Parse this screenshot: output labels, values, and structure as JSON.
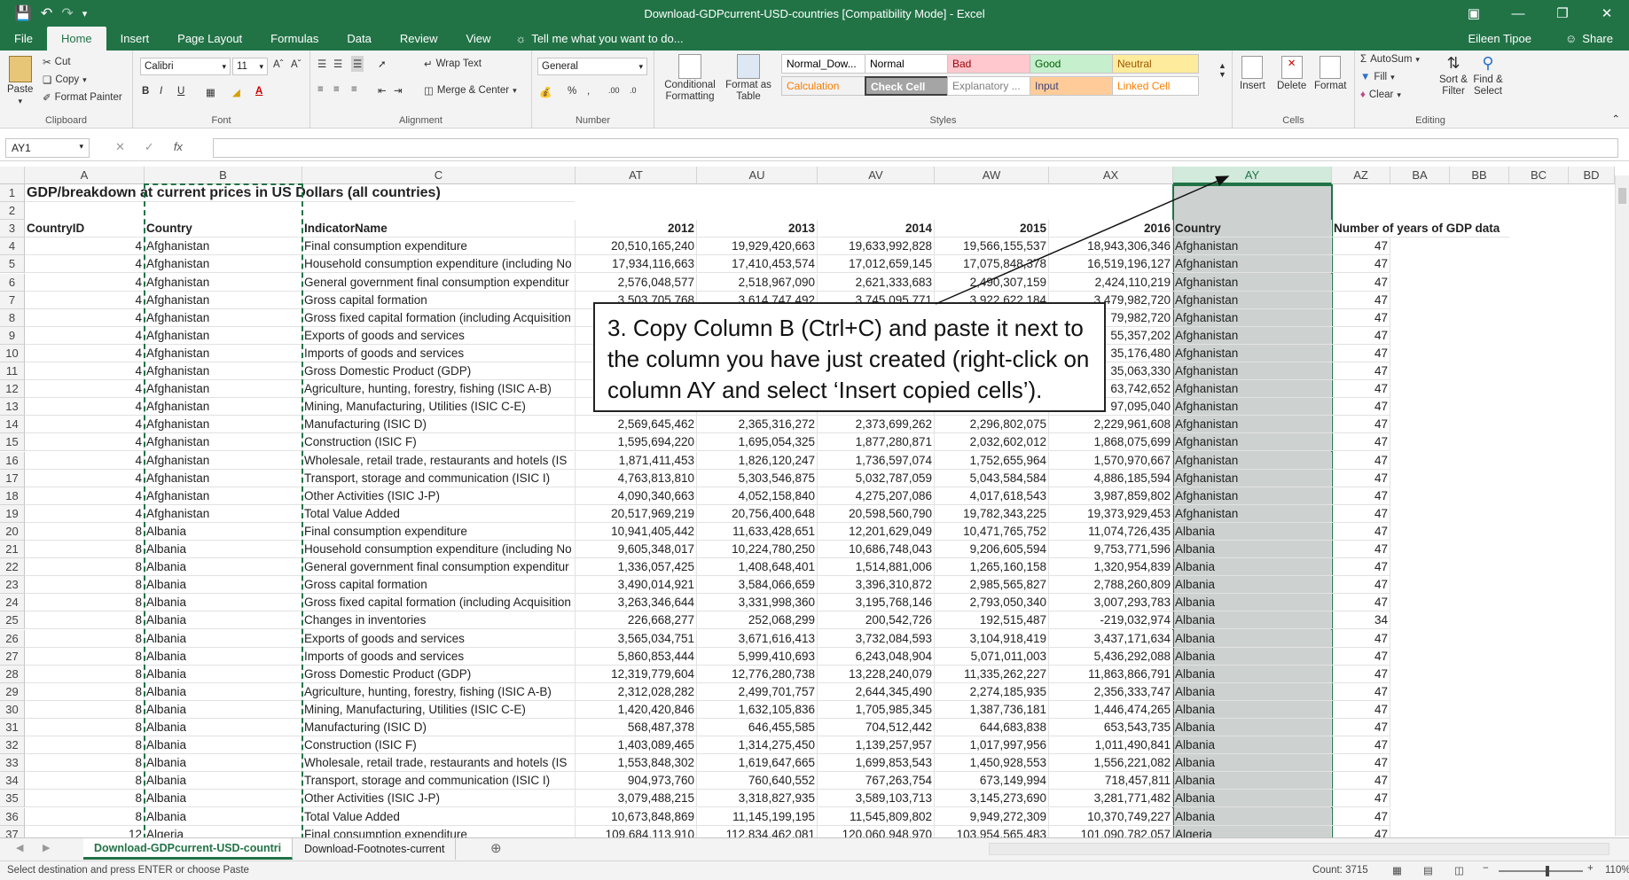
{
  "window": {
    "title": "Download-GDPcurrent-USD-countries  [Compatibility Mode] - Excel"
  },
  "tabs": [
    "File",
    "Home",
    "Insert",
    "Page Layout",
    "Formulas",
    "Data",
    "Review",
    "View"
  ],
  "tell_me": "Tell me what you want to do...",
  "user": "Eileen Tipoe",
  "share": "Share",
  "ribbon": {
    "clipboard": {
      "paste": "Paste",
      "cut": "Cut",
      "copy": "Copy",
      "format_painter": "Format Painter",
      "label": "Clipboard"
    },
    "font": {
      "name": "Calibri",
      "size": "11",
      "label": "Font"
    },
    "alignment": {
      "wrap": "Wrap Text",
      "merge": "Merge & Center",
      "label": "Alignment"
    },
    "number": {
      "format": "General",
      "label": "Number"
    },
    "styles": {
      "cond_fmt": "Conditional Formatting",
      "format_table": "Format as Table",
      "cells": [
        {
          "text": "Normal_Dow...",
          "bg": "#ffffff",
          "fg": "#000000"
        },
        {
          "text": "Normal",
          "bg": "#ffffff",
          "fg": "#000000"
        },
        {
          "text": "Bad",
          "bg": "#ffc7ce",
          "fg": "#9c0006"
        },
        {
          "text": "Good",
          "bg": "#c6efce",
          "fg": "#006100"
        },
        {
          "text": "Neutral",
          "bg": "#ffeb9c",
          "fg": "#9c5700"
        },
        {
          "text": "Calculation",
          "bg": "#f2f2f2",
          "fg": "#fa7d00"
        },
        {
          "text": "Check Cell",
          "bg": "#a5a5a5",
          "fg": "#ffffff"
        },
        {
          "text": "Explanatory ...",
          "bg": "#ffffff",
          "fg": "#7f7f7f"
        },
        {
          "text": "Input",
          "bg": "#ffcc99",
          "fg": "#3f3f76"
        },
        {
          "text": "Linked Cell",
          "bg": "#ffffff",
          "fg": "#fa7d00"
        }
      ],
      "label": "Styles"
    },
    "cells": {
      "insert": "Insert",
      "delete": "Delete",
      "format": "Format",
      "label": "Cells"
    },
    "editing": {
      "autosum": "AutoSum",
      "fill": "Fill",
      "clear": "Clear",
      "sort": "Sort & Filter",
      "find": "Find & Select",
      "label": "Editing"
    }
  },
  "formula_bar": {
    "name_box": "AY1",
    "fx": "fx",
    "value": ""
  },
  "columns": [
    "A",
    "B",
    "C",
    "AT",
    "AU",
    "AV",
    "AW",
    "AX",
    "AY",
    "AZ",
    "BA",
    "BB",
    "BC",
    "BD"
  ],
  "row1_title": "GDP/breakdown at current prices in US Dollars (all countries)",
  "headers": {
    "A": "CountryID",
    "B": "Country",
    "C": "IndicatorName",
    "AT": "2012",
    "AU": "2013",
    "AV": "2014",
    "AW": "2015",
    "AX": "2016",
    "AY": "Country",
    "AZ": "Number of years of GDP data"
  },
  "rows": [
    {
      "n": "4",
      "id": "4",
      "country": "Afghanistan",
      "ind": "Final consumption expenditure",
      "v": [
        "20,510,165,240",
        "19,929,420,663",
        "19,633,992,828",
        "19,566,155,537",
        "18,943,306,346"
      ],
      "ay": "Afghanistan",
      "az": "47"
    },
    {
      "n": "5",
      "id": "4",
      "country": "Afghanistan",
      "ind": "Household consumption expenditure (including No",
      "v": [
        "17,934,116,663",
        "17,410,453,574",
        "17,012,659,145",
        "17,075,848,378",
        "16,519,196,127"
      ],
      "ay": "Afghanistan",
      "az": "47"
    },
    {
      "n": "6",
      "id": "4",
      "country": "Afghanistan",
      "ind": "General government final consumption expenditur",
      "v": [
        "2,576,048,577",
        "2,518,967,090",
        "2,621,333,683",
        "2,490,307,159",
        "2,424,110,219"
      ],
      "ay": "Afghanistan",
      "az": "47"
    },
    {
      "n": "7",
      "id": "4",
      "country": "Afghanistan",
      "ind": "Gross capital formation",
      "v": [
        "3,503,705,768",
        "3,614,747,492",
        "3,745,095,771",
        "3,922,622,184",
        "3,479,982,720"
      ],
      "ay": "Afghanistan",
      "az": "47"
    },
    {
      "n": "8",
      "id": "4",
      "country": "Afghanistan",
      "ind": "Gross fixed capital formation (including Acquisition",
      "v": [
        "",
        "",
        "",
        "",
        "79,982,720"
      ],
      "ay": "Afghanistan",
      "az": "47"
    },
    {
      "n": "9",
      "id": "4",
      "country": "Afghanistan",
      "ind": "Exports of goods and services",
      "v": [
        "",
        "",
        "",
        "",
        "55,357,202"
      ],
      "ay": "Afghanistan",
      "az": "47"
    },
    {
      "n": "10",
      "id": "4",
      "country": "Afghanistan",
      "ind": "Imports of goods and services",
      "v": [
        "",
        "",
        "",
        "",
        "35,176,480"
      ],
      "ay": "Afghanistan",
      "az": "47"
    },
    {
      "n": "11",
      "id": "4",
      "country": "Afghanistan",
      "ind": "Gross Domestic Product (GDP)",
      "v": [
        "",
        "",
        "",
        "",
        "35,063,330"
      ],
      "ay": "Afghanistan",
      "az": "47"
    },
    {
      "n": "12",
      "id": "4",
      "country": "Afghanistan",
      "ind": "Agriculture, hunting, forestry, fishing (ISIC A-B)",
      "v": [
        "",
        "",
        "",
        "",
        "63,742,652"
      ],
      "ay": "Afghanistan",
      "az": "47"
    },
    {
      "n": "13",
      "id": "4",
      "country": "Afghanistan",
      "ind": "Mining, Manufacturing, Utilities (ISIC C-E)",
      "v": [
        "",
        "",
        "",
        "",
        "97,095,040"
      ],
      "ay": "Afghanistan",
      "az": "47"
    },
    {
      "n": "14",
      "id": "4",
      "country": "Afghanistan",
      "ind": "Manufacturing (ISIC D)",
      "v": [
        "2,569,645,462",
        "2,365,316,272",
        "2,373,699,262",
        "2,296,802,075",
        "2,229,961,608"
      ],
      "ay": "Afghanistan",
      "az": "47"
    },
    {
      "n": "15",
      "id": "4",
      "country": "Afghanistan",
      "ind": "Construction (ISIC F)",
      "v": [
        "1,595,694,220",
        "1,695,054,325",
        "1,877,280,871",
        "2,032,602,012",
        "1,868,075,699"
      ],
      "ay": "Afghanistan",
      "az": "47"
    },
    {
      "n": "16",
      "id": "4",
      "country": "Afghanistan",
      "ind": "Wholesale, retail trade, restaurants and hotels (IS",
      "v": [
        "1,871,411,453",
        "1,826,120,247",
        "1,736,597,074",
        "1,752,655,964",
        "1,570,970,667"
      ],
      "ay": "Afghanistan",
      "az": "47"
    },
    {
      "n": "17",
      "id": "4",
      "country": "Afghanistan",
      "ind": "Transport, storage and communication (ISIC I)",
      "v": [
        "4,763,813,810",
        "5,303,546,875",
        "5,032,787,059",
        "5,043,584,584",
        "4,886,185,594"
      ],
      "ay": "Afghanistan",
      "az": "47"
    },
    {
      "n": "18",
      "id": "4",
      "country": "Afghanistan",
      "ind": "Other Activities (ISIC J-P)",
      "v": [
        "4,090,340,663",
        "4,052,158,840",
        "4,275,207,086",
        "4,017,618,543",
        "3,987,859,802"
      ],
      "ay": "Afghanistan",
      "az": "47"
    },
    {
      "n": "19",
      "id": "4",
      "country": "Afghanistan",
      "ind": "Total Value Added",
      "v": [
        "20,517,969,219",
        "20,756,400,648",
        "20,598,560,790",
        "19,782,343,225",
        "19,373,929,453"
      ],
      "ay": "Afghanistan",
      "az": "47"
    },
    {
      "n": "20",
      "id": "8",
      "country": "Albania",
      "ind": "Final consumption expenditure",
      "v": [
        "10,941,405,442",
        "11,633,428,651",
        "12,201,629,049",
        "10,471,765,752",
        "11,074,726,435"
      ],
      "ay": "Albania",
      "az": "47"
    },
    {
      "n": "21",
      "id": "8",
      "country": "Albania",
      "ind": "Household consumption expenditure (including No",
      "v": [
        "9,605,348,017",
        "10,224,780,250",
        "10,686,748,043",
        "9,206,605,594",
        "9,753,771,596"
      ],
      "ay": "Albania",
      "az": "47"
    },
    {
      "n": "22",
      "id": "8",
      "country": "Albania",
      "ind": "General government final consumption expenditur",
      "v": [
        "1,336,057,425",
        "1,408,648,401",
        "1,514,881,006",
        "1,265,160,158",
        "1,320,954,839"
      ],
      "ay": "Albania",
      "az": "47"
    },
    {
      "n": "23",
      "id": "8",
      "country": "Albania",
      "ind": "Gross capital formation",
      "v": [
        "3,490,014,921",
        "3,584,066,659",
        "3,396,310,872",
        "2,985,565,827",
        "2,788,260,809"
      ],
      "ay": "Albania",
      "az": "47"
    },
    {
      "n": "24",
      "id": "8",
      "country": "Albania",
      "ind": "Gross fixed capital formation (including Acquisition",
      "v": [
        "3,263,346,644",
        "3,331,998,360",
        "3,195,768,146",
        "2,793,050,340",
        "3,007,293,783"
      ],
      "ay": "Albania",
      "az": "47"
    },
    {
      "n": "25",
      "id": "8",
      "country": "Albania",
      "ind": "Changes in inventories",
      "v": [
        "226,668,277",
        "252,068,299",
        "200,542,726",
        "192,515,487",
        "-219,032,974"
      ],
      "ay": "Albania",
      "az": "34"
    },
    {
      "n": "26",
      "id": "8",
      "country": "Albania",
      "ind": "Exports of goods and services",
      "v": [
        "3,565,034,751",
        "3,671,616,413",
        "3,732,084,593",
        "3,104,918,419",
        "3,437,171,634"
      ],
      "ay": "Albania",
      "az": "47"
    },
    {
      "n": "27",
      "id": "8",
      "country": "Albania",
      "ind": "Imports of goods and services",
      "v": [
        "5,860,853,444",
        "5,999,410,693",
        "6,243,048,904",
        "5,071,011,003",
        "5,436,292,088"
      ],
      "ay": "Albania",
      "az": "47"
    },
    {
      "n": "28",
      "id": "8",
      "country": "Albania",
      "ind": "Gross Domestic Product (GDP)",
      "v": [
        "12,319,779,604",
        "12,776,280,738",
        "13,228,240,079",
        "11,335,262,227",
        "11,863,866,791"
      ],
      "ay": "Albania",
      "az": "47"
    },
    {
      "n": "29",
      "id": "8",
      "country": "Albania",
      "ind": "Agriculture, hunting, forestry, fishing (ISIC A-B)",
      "v": [
        "2,312,028,282",
        "2,499,701,757",
        "2,644,345,490",
        "2,274,185,935",
        "2,356,333,747"
      ],
      "ay": "Albania",
      "az": "47"
    },
    {
      "n": "30",
      "id": "8",
      "country": "Albania",
      "ind": "Mining, Manufacturing, Utilities (ISIC C-E)",
      "v": [
        "1,420,420,846",
        "1,632,105,836",
        "1,705,985,345",
        "1,387,736,181",
        "1,446,474,265"
      ],
      "ay": "Albania",
      "az": "47"
    },
    {
      "n": "31",
      "id": "8",
      "country": "Albania",
      "ind": "Manufacturing (ISIC D)",
      "v": [
        "568,487,378",
        "646,455,585",
        "704,512,442",
        "644,683,838",
        "653,543,735"
      ],
      "ay": "Albania",
      "az": "47"
    },
    {
      "n": "32",
      "id": "8",
      "country": "Albania",
      "ind": "Construction (ISIC F)",
      "v": [
        "1,403,089,465",
        "1,314,275,450",
        "1,139,257,957",
        "1,017,997,956",
        "1,011,490,841"
      ],
      "ay": "Albania",
      "az": "47"
    },
    {
      "n": "33",
      "id": "8",
      "country": "Albania",
      "ind": "Wholesale, retail trade, restaurants and hotels (IS",
      "v": [
        "1,553,848,302",
        "1,619,647,665",
        "1,699,853,543",
        "1,450,928,553",
        "1,556,221,082"
      ],
      "ay": "Albania",
      "az": "47"
    },
    {
      "n": "34",
      "id": "8",
      "country": "Albania",
      "ind": "Transport, storage and communication (ISIC I)",
      "v": [
        "904,973,760",
        "760,640,552",
        "767,263,754",
        "673,149,994",
        "718,457,811"
      ],
      "ay": "Albania",
      "az": "47"
    },
    {
      "n": "35",
      "id": "8",
      "country": "Albania",
      "ind": "Other Activities (ISIC J-P)",
      "v": [
        "3,079,488,215",
        "3,318,827,935",
        "3,589,103,713",
        "3,145,273,690",
        "3,281,771,482"
      ],
      "ay": "Albania",
      "az": "47"
    },
    {
      "n": "36",
      "id": "8",
      "country": "Albania",
      "ind": "Total Value Added",
      "v": [
        "10,673,848,869",
        "11,145,199,195",
        "11,545,809,802",
        "9,949,272,309",
        "10,370,749,227"
      ],
      "ay": "Albania",
      "az": "47"
    },
    {
      "n": "37",
      "id": "12",
      "country": "Algeria",
      "ind": "Final consumption expenditure",
      "v": [
        "109,684,113,910",
        "112,834,462,081",
        "120,060,948,970",
        "103,954,565,483",
        "101,090,782,057"
      ],
      "ay": "Algeria",
      "az": "47"
    }
  ],
  "callout": "3. Copy Column B (Ctrl+C) and paste it next to the column you have just created (right-click on column AY and select ‘Insert copied cells’).",
  "sheet_tabs": [
    "Download-GDPcurrent-USD-countri",
    "Download-Footnotes-current"
  ],
  "status": {
    "message": "Select destination and press ENTER or choose Paste",
    "count": "Count: 3715",
    "zoom": "110%"
  }
}
